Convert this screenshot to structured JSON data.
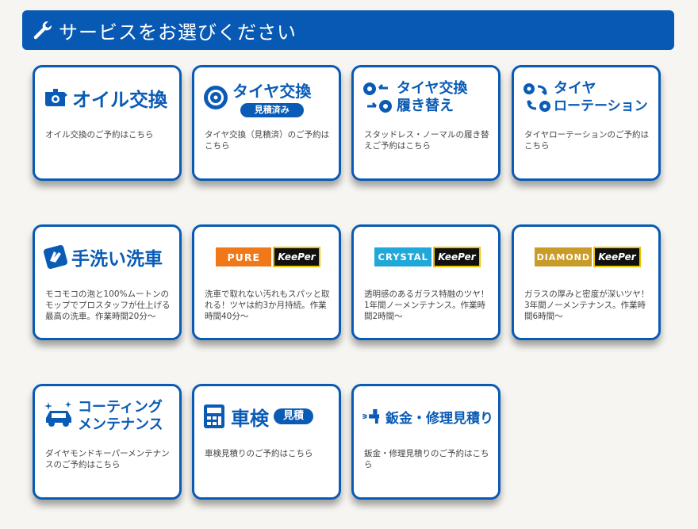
{
  "header": {
    "title": "サービスをお選びください",
    "icon": "wrench-icon"
  },
  "cards": [
    {
      "title": "オイル交換",
      "desc": "オイル交換のご予約はこちら"
    },
    {
      "title": "タイヤ交換",
      "badge": "見積済み",
      "desc": "タイヤ交換（見積済）のご予約はこちら"
    },
    {
      "title_line1": "タイヤ交換",
      "title_line2": "履き替え",
      "desc": "スタッドレス・ノーマルの履き替えご予約はこちら"
    },
    {
      "title_line1": "タイヤ",
      "title_line2": "ローテーション",
      "desc": "タイヤローテーションのご予約はこちら"
    },
    {
      "title": "手洗い洗車",
      "desc": "モコモコの泡と100%ムートンのモップでプロスタッフが仕上げる最高の洗車。作業時間20分〜"
    },
    {
      "badge_word": "PURE",
      "brand": "KeePer",
      "desc": "洗車で取れない汚れもスパッと取れる！ツヤは約3か月持続。作業時間40分〜"
    },
    {
      "badge_word": "CRYSTAL",
      "brand": "KeePer",
      "desc": "透明感のあるガラス特融のツヤ！1年間ノーメンテナンス。作業時間2時間〜"
    },
    {
      "badge_word": "DIAMOND",
      "brand": "KeePer",
      "desc": "ガラスの厚みと密度が深いツヤ！3年間ノーメンテナンス。作業時間6時間〜"
    },
    {
      "title_line1": "コーティング",
      "title_line2": "メンテナンス",
      "desc": "ダイヤモンドキーパーメンテナンスのご予約はこちら"
    },
    {
      "title": "車検",
      "badge": "見積",
      "desc": "車検見積りのご予約はこちら"
    },
    {
      "title": "鈑金・修理見積り",
      "desc": "鈑金・修理見積りのご予約はこちら"
    }
  ],
  "colors": {
    "primary": "#0a5bb5",
    "pure": "#f07818",
    "crystal": "#22a8d8",
    "diamond": "#c99c2a",
    "keeper_border": "#f0c200"
  }
}
